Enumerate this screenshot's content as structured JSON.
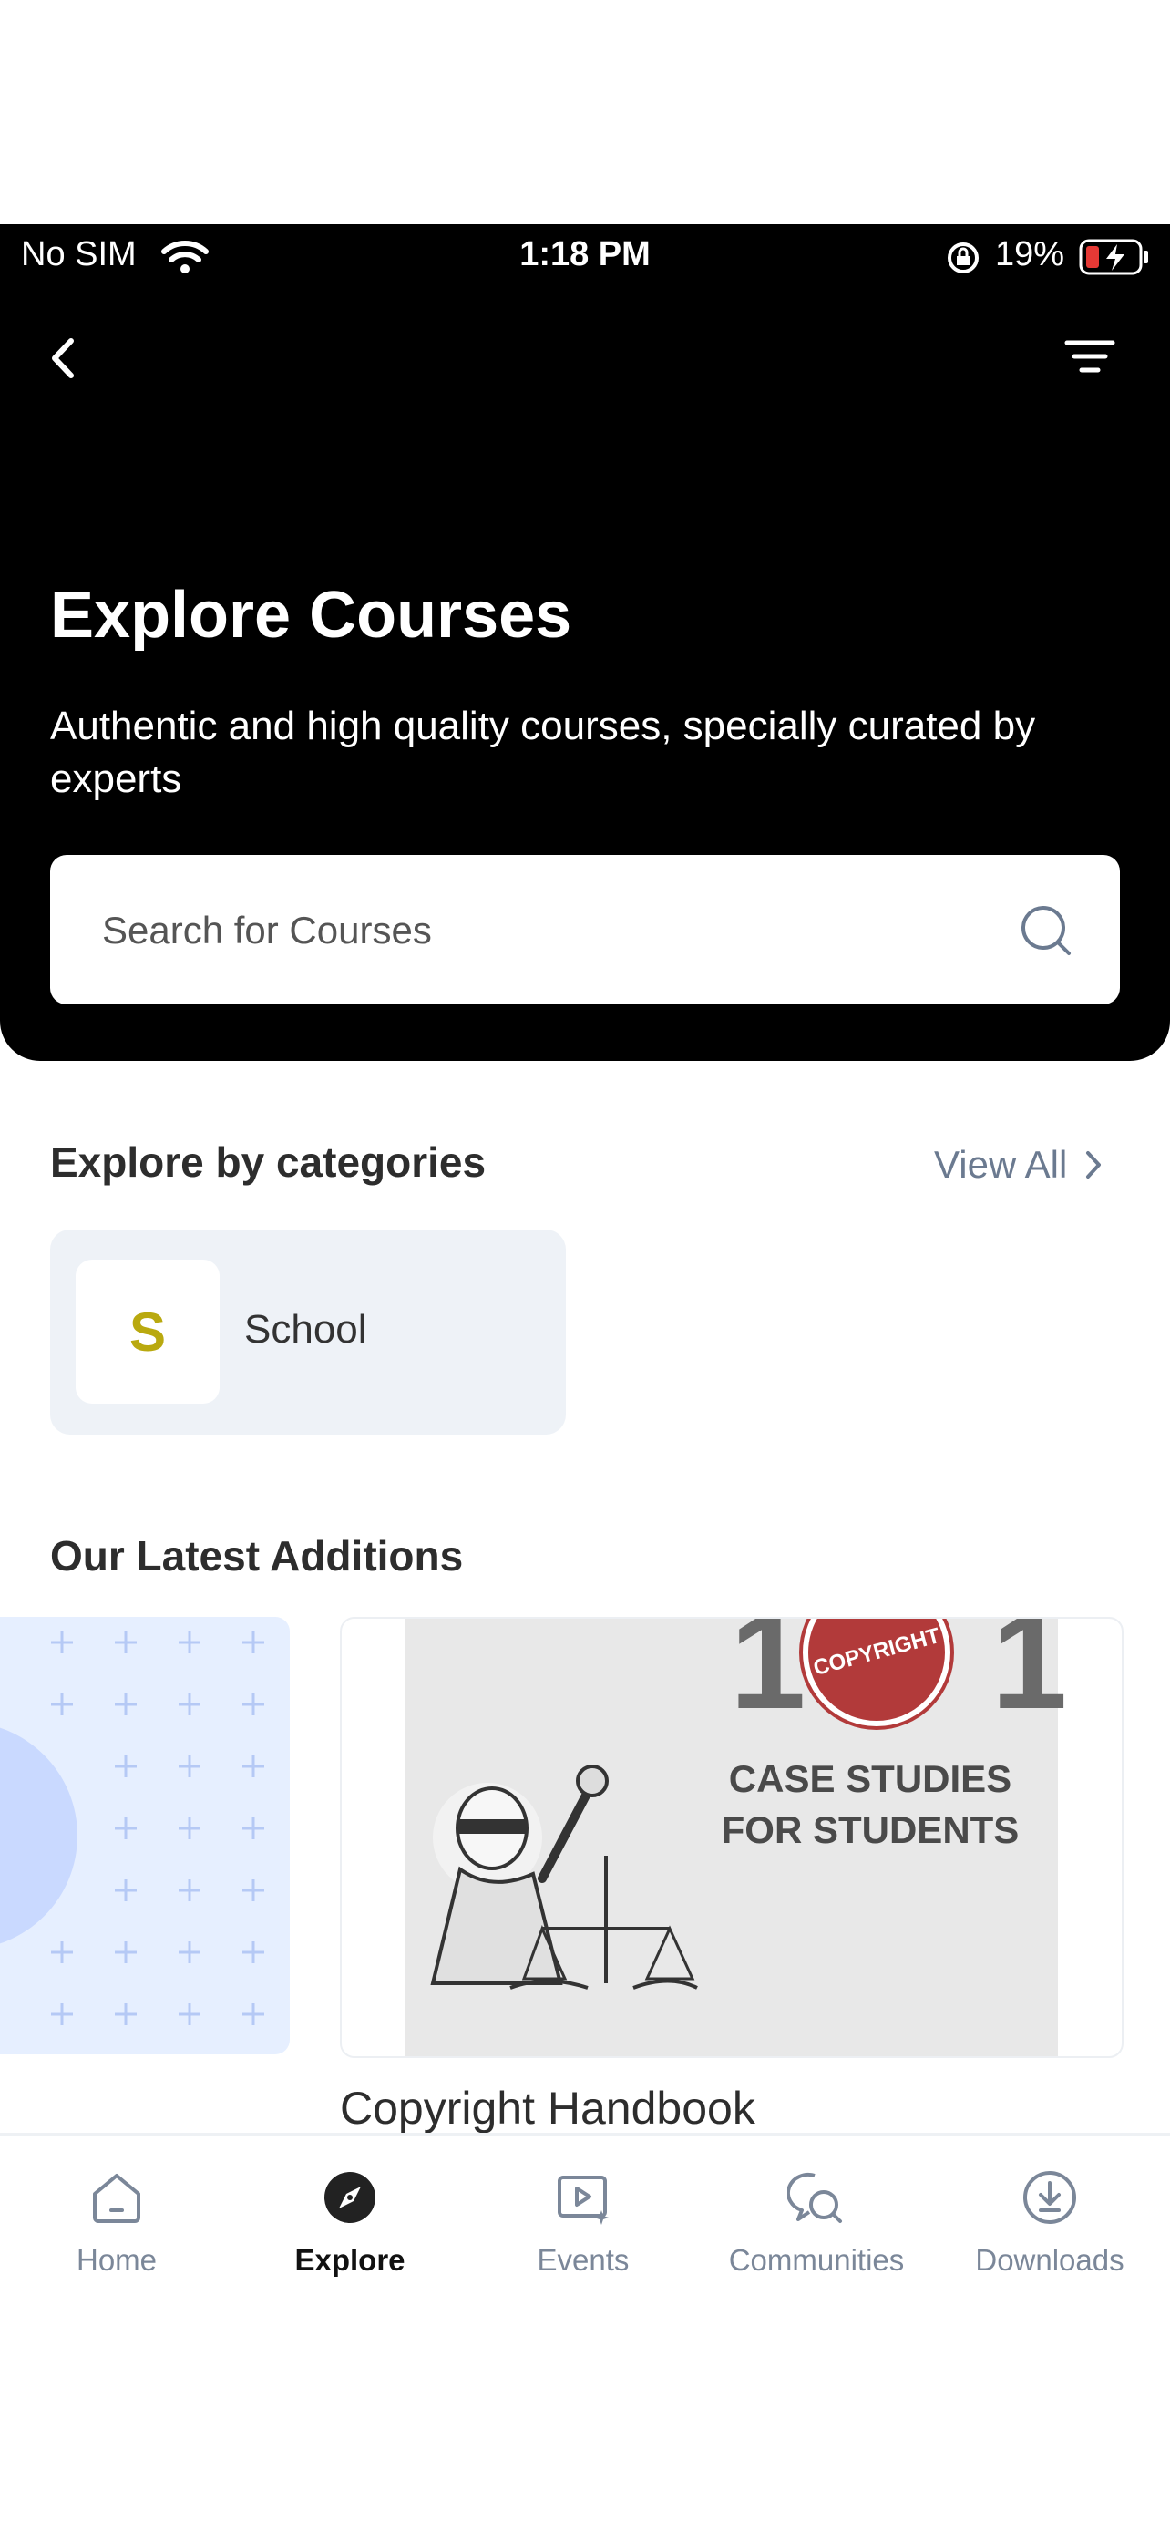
{
  "status_bar": {
    "carrier": "No SIM",
    "time": "1:18 PM",
    "battery": "19%"
  },
  "header": {
    "title": "Explore Courses",
    "subtitle": "Authentic and high quality courses, specially curated by experts",
    "icons": [
      "back-icon",
      "filter-icon"
    ]
  },
  "search": {
    "placeholder": "Search for Courses",
    "value": ""
  },
  "categories": {
    "title": "Explore by categories",
    "view_all": "View All",
    "items": [
      {
        "initial": "S",
        "label": "School"
      }
    ]
  },
  "latest": {
    "title": "Our Latest Additions",
    "courses": [
      {
        "title": "Copyright Handbook",
        "cover_lines": [
          "CASE STUDIES",
          "FOR STUDENTS"
        ],
        "cover_number": "101",
        "stamp": "COPYRIGHT"
      }
    ]
  },
  "bottom_nav": {
    "items": [
      {
        "label": "Home",
        "icon": "home-icon",
        "active": false
      },
      {
        "label": "Explore",
        "icon": "compass-icon",
        "active": true
      },
      {
        "label": "Events",
        "icon": "video-event-icon",
        "active": false
      },
      {
        "label": "Communities",
        "icon": "chat-bubbles-icon",
        "active": false
      },
      {
        "label": "Downloads",
        "icon": "download-icon",
        "active": false
      }
    ]
  },
  "colors": {
    "accent": "#b9a90f",
    "header_bg": "#000000",
    "muted": "#7b8799",
    "battery_low": "#e53935"
  }
}
